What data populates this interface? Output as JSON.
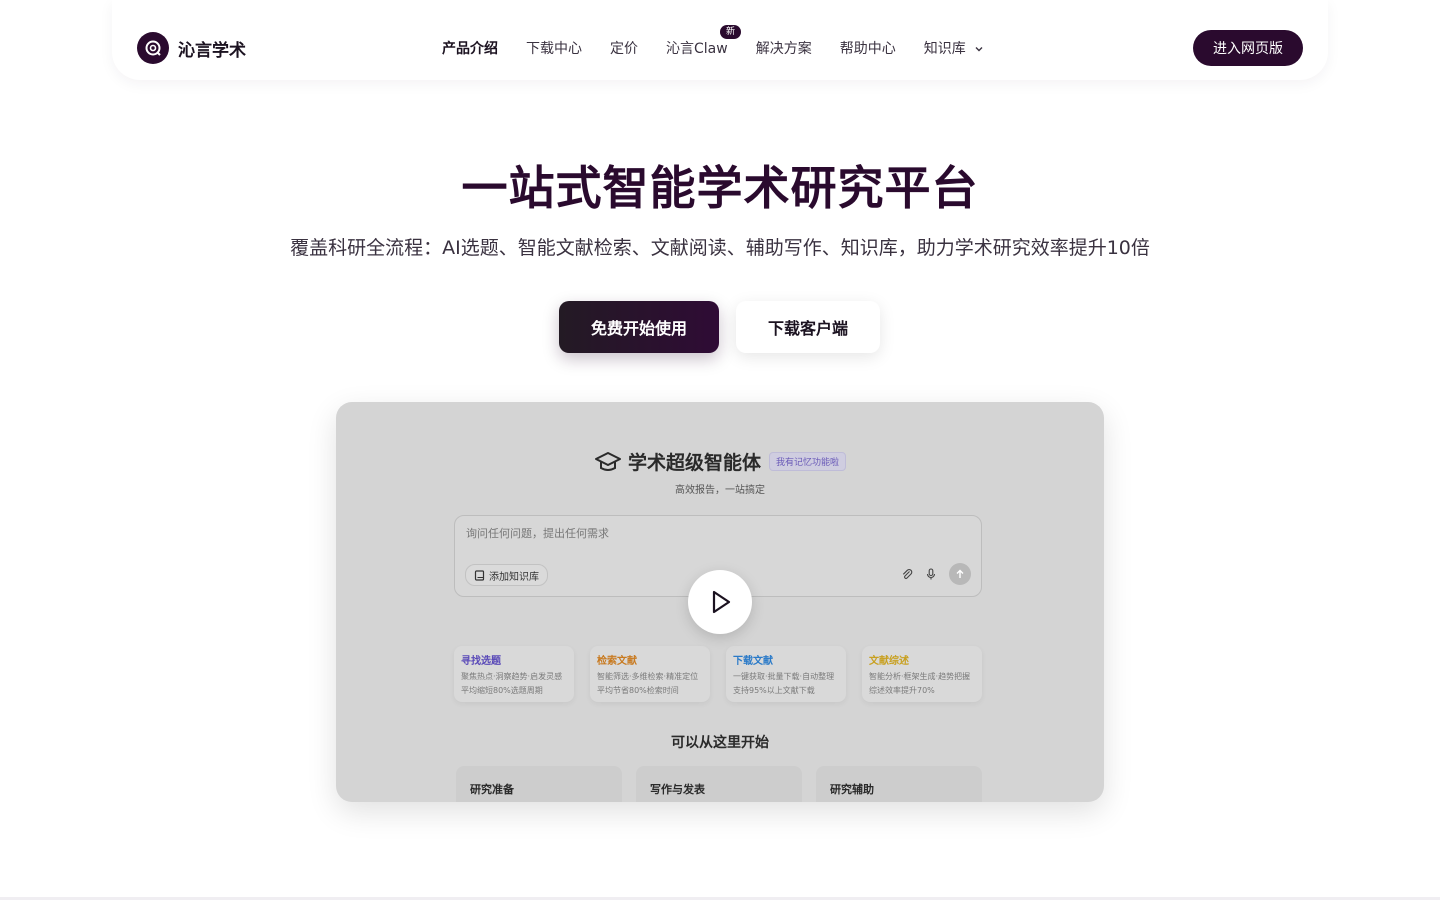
{
  "brand": {
    "name": "沁言学术",
    "primary_color": "#2a0a2e"
  },
  "nav": {
    "items": [
      {
        "label": "产品介绍",
        "active": true
      },
      {
        "label": "下载中心"
      },
      {
        "label": "定价"
      },
      {
        "label": "沁言Claw",
        "badge": "新"
      },
      {
        "label": "解决方案"
      },
      {
        "label": "帮助中心"
      },
      {
        "label": "知识库",
        "icon": "chevron-down-icon"
      }
    ],
    "cta": "进入网页版"
  },
  "hero": {
    "title": "一站式智能学术研究平台",
    "subtitle": "覆盖科研全流程：AI选题、智能文献检索、文献阅读、辅助写作、知识库，助力学术研究效率提升10倍",
    "primary_button": "免费开始使用",
    "secondary_button": "下载客户端"
  },
  "video": {
    "title": "学术超级智能体",
    "memory_badge": "我有记忆功能啦",
    "subtitle": "高效报告，一站搞定",
    "input_placeholder": "询问任何问题，提出任何需求",
    "add_kb_button": "添加知识库",
    "cards": [
      {
        "title": "寻找选题",
        "desc": "聚焦热点·洞察趋势·启发灵感",
        "stat": "平均缩短80%选题周期",
        "color": "#5a4ab8"
      },
      {
        "title": "检索文献",
        "desc": "智能筛选·多维检索·精准定位",
        "stat": "平均节省80%检索时间",
        "color": "#c87a20"
      },
      {
        "title": "下载文献",
        "desc": "一键获取·批量下载·自动整理",
        "stat": "支持95%以上文献下载",
        "color": "#2a7ac8"
      },
      {
        "title": "文献综述",
        "desc": "智能分析·框架生成·趋势把握",
        "stat": "综述效率提升70%",
        "color": "#c8a020"
      }
    ],
    "start_label": "可以从这里开始",
    "categories": [
      "研究准备",
      "写作与发表",
      "研究辅助"
    ]
  }
}
